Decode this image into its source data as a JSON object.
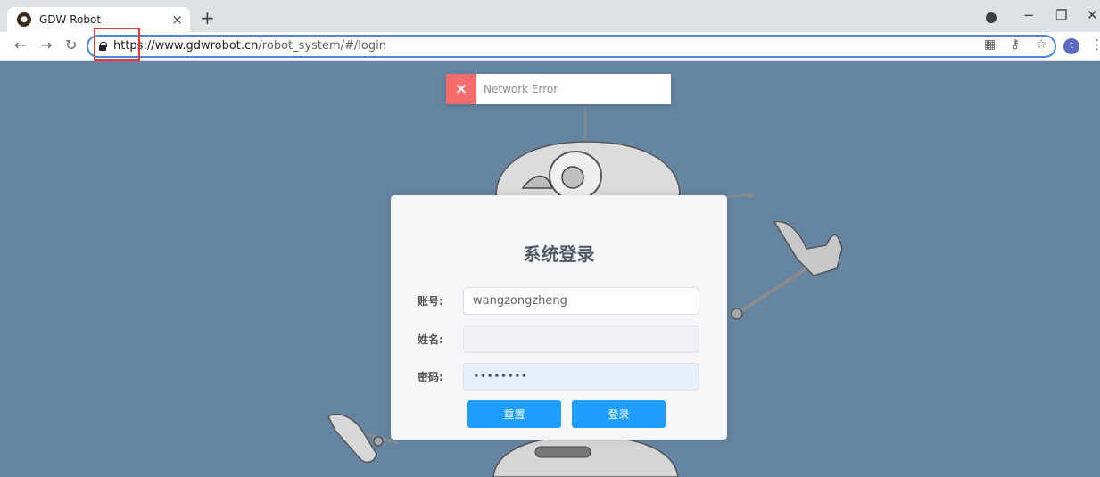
{
  "browser": {
    "tab_title": "GDW Robot",
    "tab_close": "×",
    "new_tab": "+",
    "url_scheme": "https",
    "url_sep": "://",
    "url_host": "www.gdwrobot.cn",
    "url_path": "/robot_system/#/login",
    "avatar_letter": "t"
  },
  "toast": {
    "icon": "×",
    "message": "Network Error",
    "accent": "#f56c6c"
  },
  "login": {
    "title": "系统登录",
    "account_label": "账号:",
    "account_value": "wangzongzheng",
    "name_label": "姓名:",
    "name_value": "",
    "password_label": "密码:",
    "password_value": "••••••••",
    "reset_button": "重置",
    "login_button": "登录",
    "button_color": "#1e9fff"
  },
  "colors": {
    "page_background": "#6685a3",
    "highlight_box": "#e53935"
  }
}
